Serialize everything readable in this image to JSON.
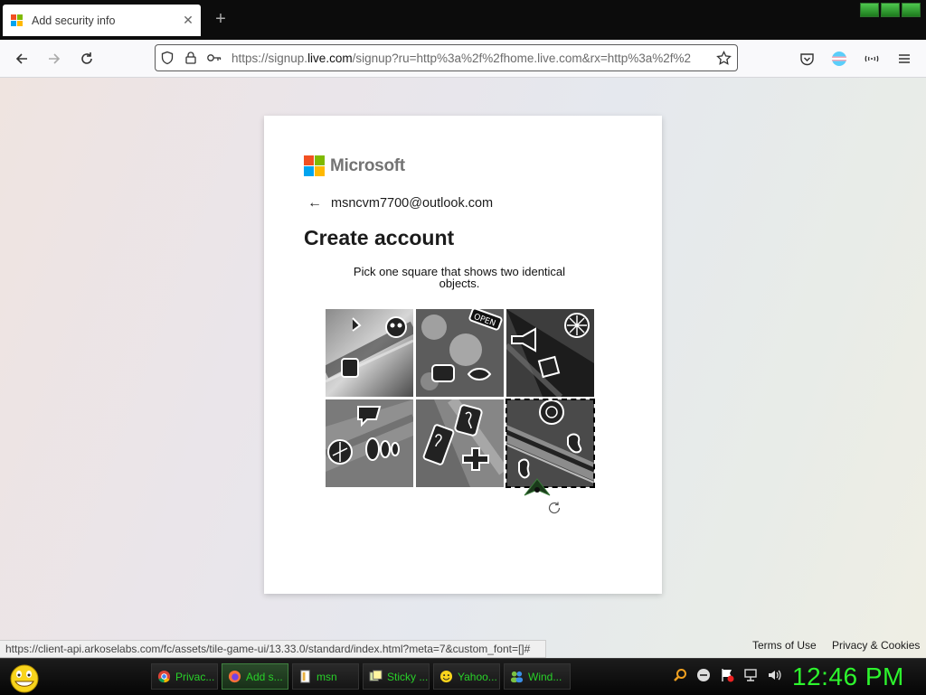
{
  "browser": {
    "tab_title": "Add security info",
    "new_tab_symbol": "+",
    "close_symbol": "✕",
    "url_prefix": "https://signup.",
    "url_domain": "live.com",
    "url_rest": "/signup?ru=http%3a%2f%2fhome.live.com&rx=http%3a%2f%2",
    "icons": [
      "back-icon",
      "forward-icon",
      "reload-icon",
      "shield-icon",
      "lock-icon",
      "key-icon",
      "star-icon",
      "pocket-icon",
      "avatar-icon",
      "extensions-icon",
      "menu-icon"
    ],
    "status_url": "https://client-api.arkoselabs.com/fc/assets/tile-game-ui/13.33.0/standard/index.html?meta=7&custom_font=[]#"
  },
  "card": {
    "brand": "Microsoft",
    "back_arrow": "←",
    "email": "msncvm7700@outlook.com",
    "title": "Create account",
    "instruction": "Pick one square that shows two identical objects.",
    "tile_count": 6,
    "selected_tile": 6
  },
  "footer": {
    "terms": "Terms of Use",
    "privacy": "Privacy & Cookies"
  },
  "taskbar": {
    "items": [
      "Privac...",
      "Add s...",
      "msn",
      "Sticky ...",
      "Yahoo...",
      "Wind..."
    ],
    "active_index": 1,
    "clock": "12:46 PM"
  },
  "colors": {
    "ms_red": "#f25022",
    "ms_green": "#7fba00",
    "ms_blue": "#00a4ef",
    "ms_yellow": "#ffb900",
    "clock_green": "#2df52d"
  }
}
